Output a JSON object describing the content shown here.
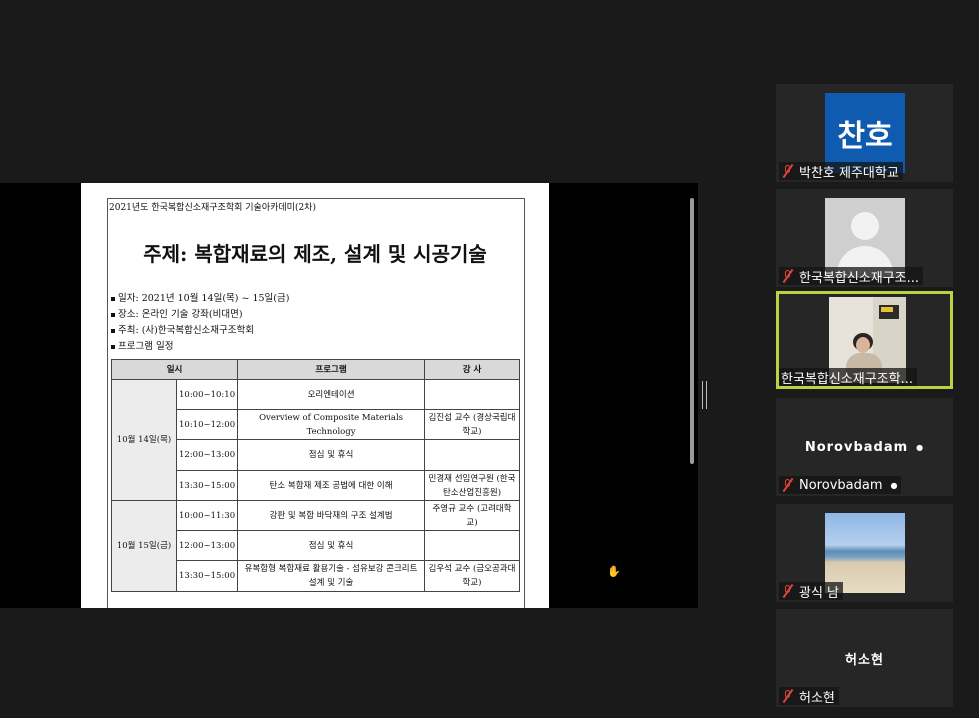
{
  "document": {
    "header_line": "2021년도 한국복합신소재구조학회 기술아카데미(2차)",
    "title": "주제: 복합재료의 제조, 설계 및 시공기술",
    "info": [
      "일자: 2021년 10월 14일(목) ~ 15일(금)",
      "장소: 온라인 기술 강좌(비대면)",
      "주최: (사)한국복합신소재구조학회",
      "프로그램 일정"
    ],
    "table": {
      "headers": [
        "일시",
        "프로그램",
        "강 사"
      ],
      "day1": "10월 14일(목)",
      "day2": "10월 15일(금)",
      "rows": [
        {
          "time": "10:00~10:10",
          "program": "오리엔테이션",
          "lecturer": ""
        },
        {
          "time": "10:10~12:00",
          "program": "Overview of Composite Materials Technology",
          "lecturer": "김진섭 교수 (경상국립대학교)"
        },
        {
          "time": "12:00~13:00",
          "program": "점심 및 휴식",
          "lecturer": ""
        },
        {
          "time": "13:30~15:00",
          "program": "탄소 복합재 제조 공법에 대한 이해",
          "lecturer": "민경재 선임연구원 (한국탄소산업진흥원)"
        },
        {
          "time": "10:00~11:30",
          "program": "강판 및 복합 바닥재의 구조 설계법",
          "lecturer": "주영규 교수 (고려대학교)"
        },
        {
          "time": "12:00~13:00",
          "program": "점심 및 휴식",
          "lecturer": ""
        },
        {
          "time": "13:30~15:00",
          "program": "유복합형 복합재료 활용기술 - 섬유보강 콘크리트 설계 및 기술",
          "lecturer": "김우석 교수 (금오공과대학교)"
        }
      ]
    }
  },
  "participants": [
    {
      "name": "박찬호 제주대학교",
      "avatar_text": "찬호",
      "avatar_color": "#0e5bb0",
      "muted": true
    },
    {
      "name": "한국복합신소재구조...",
      "muted": true
    },
    {
      "name": "한국복합신소재구조학...",
      "muted": false,
      "active": true
    },
    {
      "name": "Norovbadam",
      "display": "Norovbadam",
      "muted": true
    },
    {
      "name": "광식 남",
      "muted": true
    },
    {
      "name": "허소현",
      "display": "허소현",
      "muted": true
    }
  ],
  "colors": {
    "active_border": "#b8d442",
    "muted_icon": "#e0453a"
  }
}
